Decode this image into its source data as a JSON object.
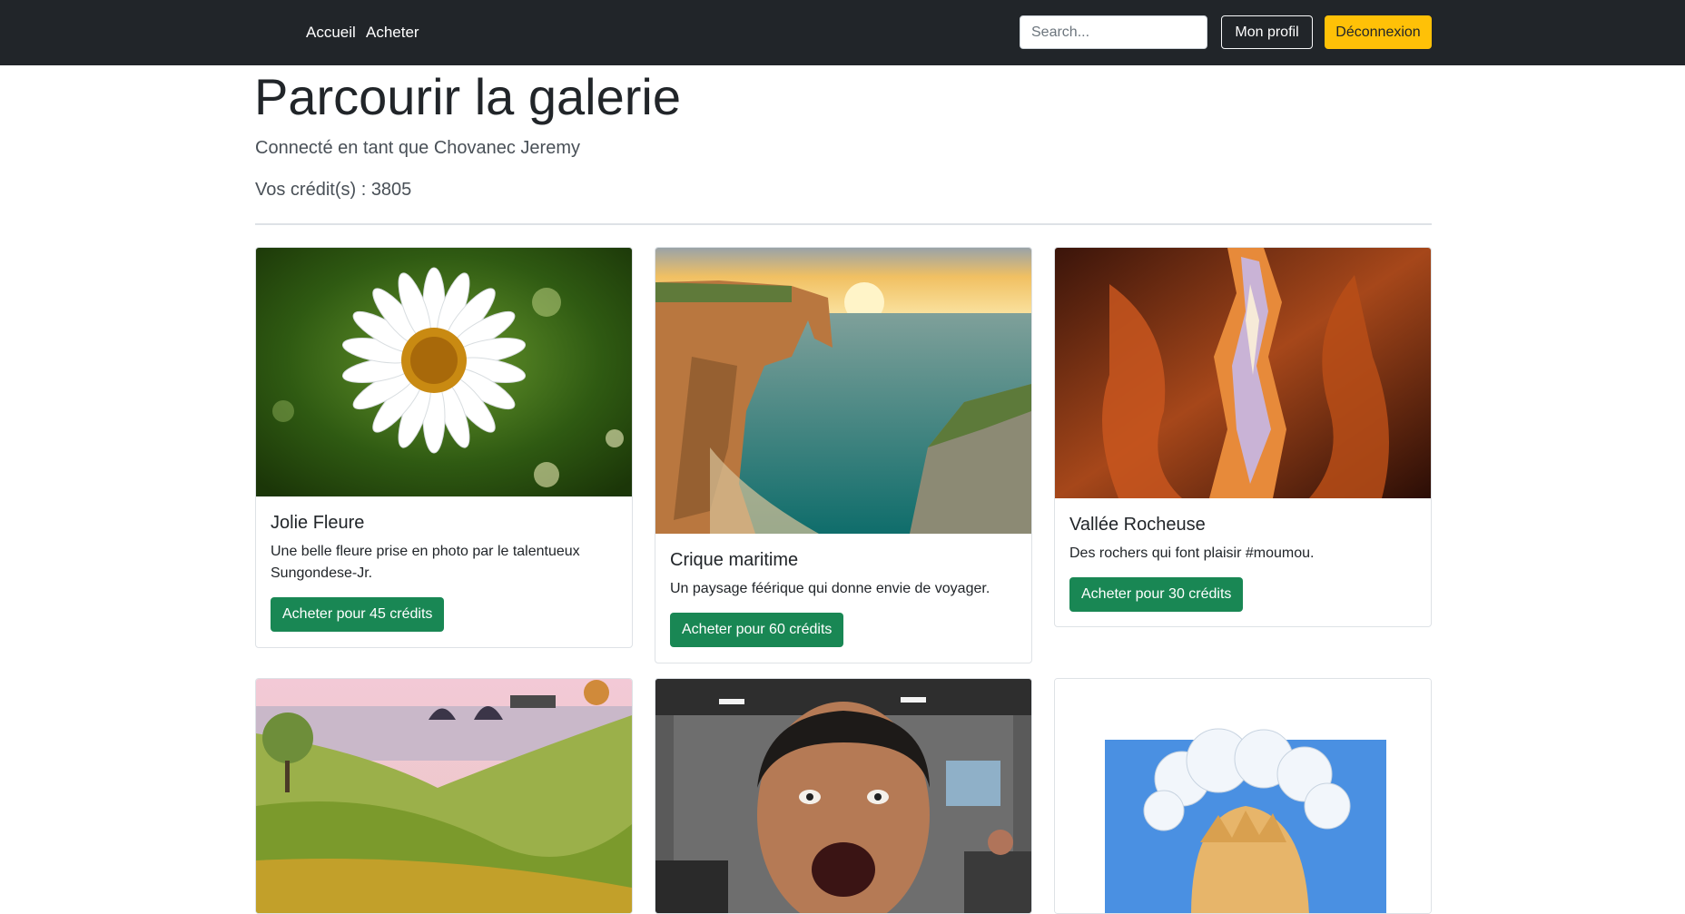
{
  "nav": {
    "links": [
      "Accueil",
      "Acheter"
    ],
    "search_placeholder": "Search...",
    "profile_label": "Mon profil",
    "logout_label": "Déconnexion"
  },
  "header": {
    "title": "Parcourir la galerie",
    "connected_as": "Connecté en tant que Chovanec Jeremy",
    "credits": "Vos crédit(s) : 3805"
  },
  "cards": [
    {
      "title": "Jolie Fleure",
      "text": "Une belle fleure prise en photo par le talentueux Sungondese-Jr.",
      "button": "Acheter pour 45 crédits",
      "image": "daisy-flower"
    },
    {
      "title": "Crique maritime",
      "text": "Un paysage féérique qui donne envie de voyager.",
      "button": "Acheter pour 60 crédits",
      "image": "sea-cliff-sunset"
    },
    {
      "title": "Vallée Rocheuse",
      "text": "Des rochers qui font plaisir #moumou.",
      "button": "Acheter pour 30 crédits",
      "image": "red-canyon"
    },
    {
      "image": "game-landscape"
    },
    {
      "image": "screaming-man"
    },
    {
      "image": "anime-character-clouds"
    }
  ],
  "colors": {
    "navbar": "#212529",
    "logout": "#ffc107",
    "buy_button": "#198754"
  }
}
